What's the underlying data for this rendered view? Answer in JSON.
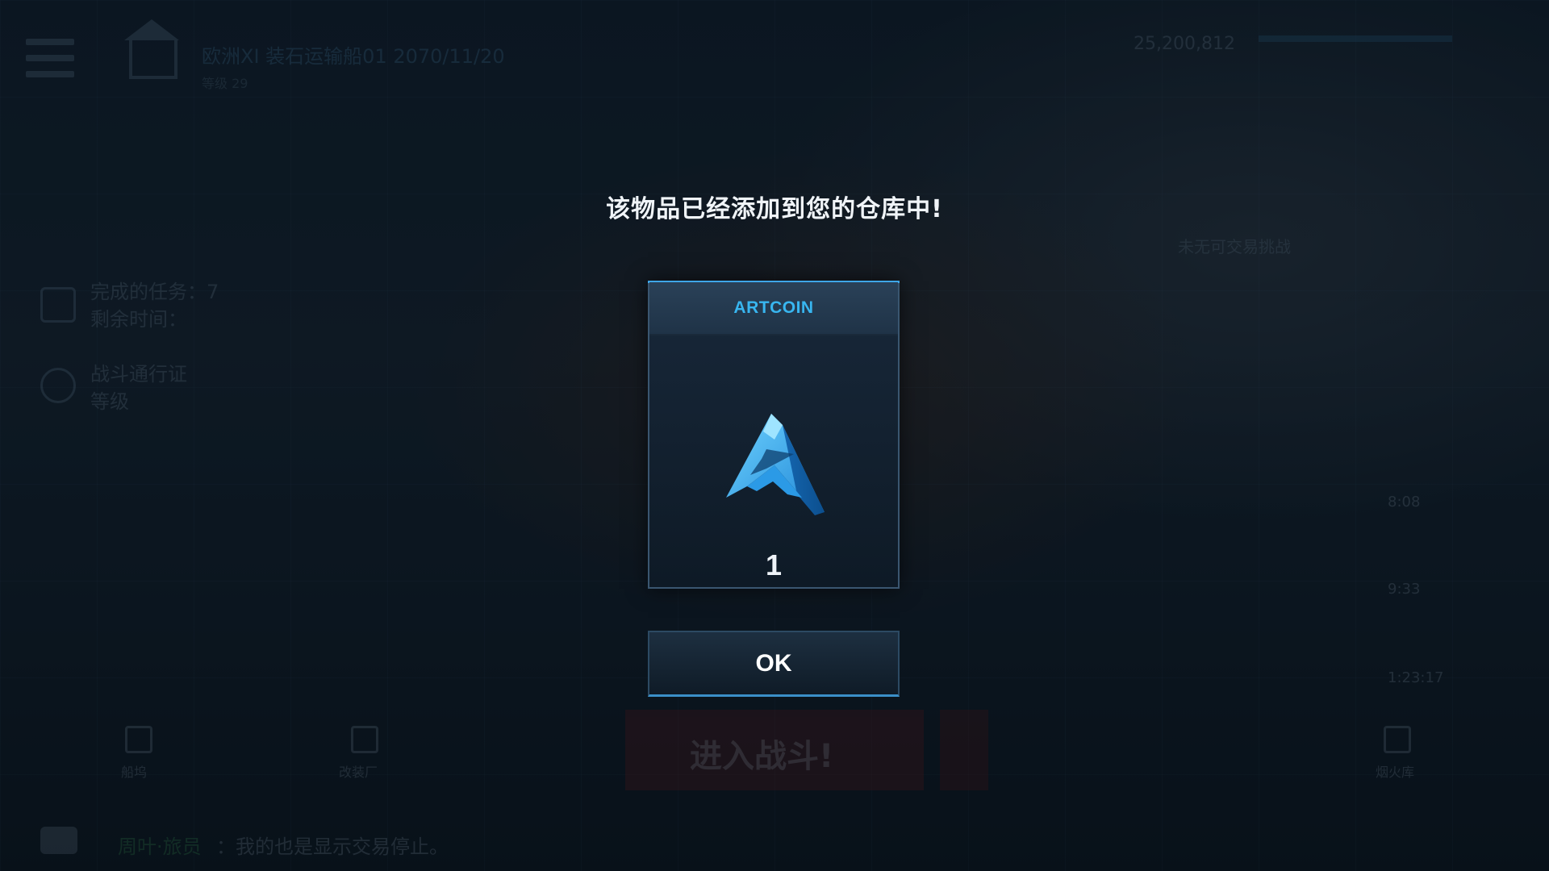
{
  "background_hud": {
    "player_line": "欧洲XI 装石运输船01 2070/11/20",
    "player_sub": "等级 29",
    "credits": "25,200,812",
    "tasks": [
      {
        "line1": "完成的任务：7",
        "line2": "剩余时间："
      },
      {
        "line1": "战斗通行证",
        "line2": "等级"
      }
    ],
    "cargo_note": "未无可交易挑战",
    "timers": [
      "8:08",
      "9:33",
      "1:23:17"
    ],
    "battle_label": "进入战斗!",
    "nav": [
      {
        "label": "船坞"
      },
      {
        "label": "改装厂"
      },
      {
        "label": "烟火库"
      }
    ],
    "chat": {
      "name": "周叶·旅员",
      "message": "：我的也是显示交易停止。"
    }
  },
  "dialog": {
    "title": "该物品已经添加到您的仓库中!",
    "item_name": "ARTCOIN",
    "item_icon": "artcoin-icon",
    "quantity": "1",
    "ok_label": "OK"
  },
  "colors": {
    "accent_blue": "#38b6f0",
    "title_white": "#f0f4f8"
  }
}
